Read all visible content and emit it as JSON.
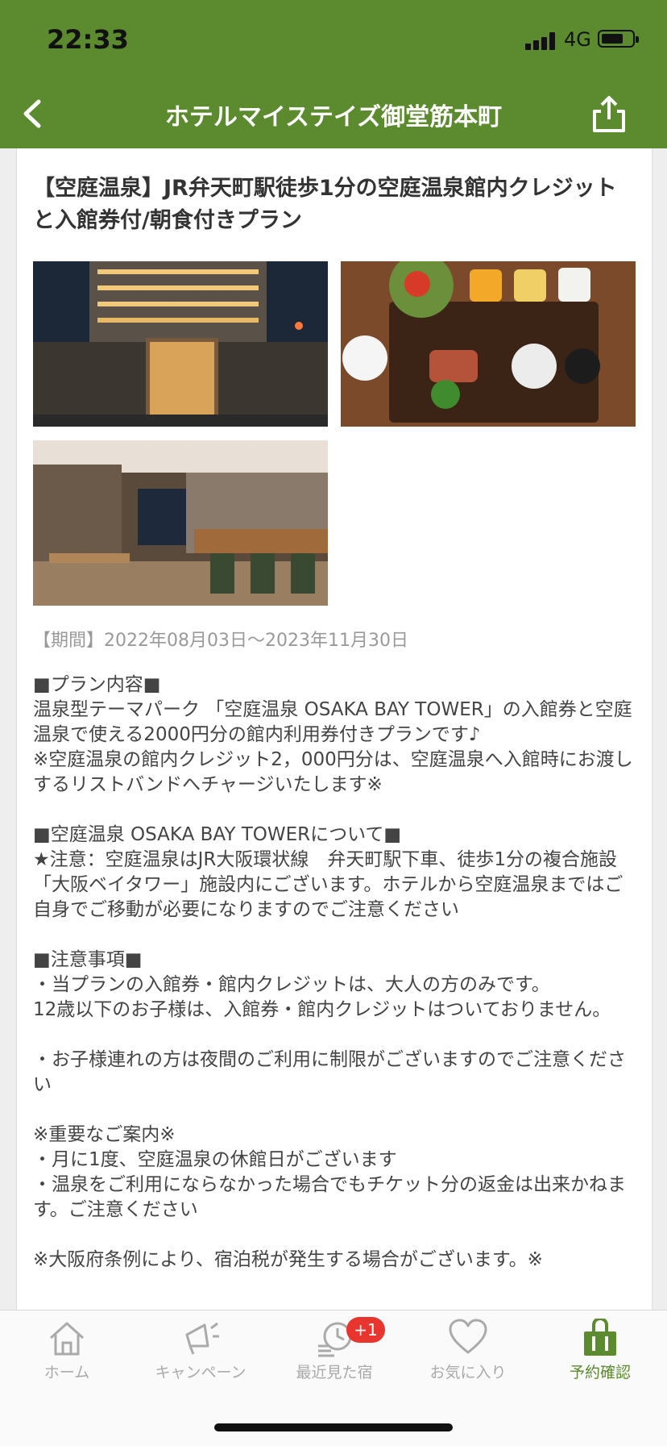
{
  "status": {
    "time": "22:33",
    "network": "4G"
  },
  "nav": {
    "title": "ホテルマイステイズ御堂筋本町",
    "back_icon": "chevron-left-icon",
    "share_icon": "share-icon"
  },
  "plan": {
    "title": "【空庭温泉】JR弁天町駅徒歩1分の空庭温泉館内クレジットと入館券付/朝食付きプラン",
    "period": "【期間】2022年08月03日～2023年11月30日",
    "photos": [
      "hotel-exterior",
      "breakfast",
      "restaurant-interior"
    ],
    "description": "■プラン内容■\n温泉型テーマパーク 「空庭温泉 OSAKA BAY TOWER」の入館券と空庭温泉で使える2000円分の館内利用券付きプランです♪\n※空庭温泉の館内クレジット2，000円分は、空庭温泉へ入館時にお渡しするリストバンドへチャージいたします※\n\n■空庭温泉 OSAKA BAY TOWERについて■\n★注意：空庭温泉はJR大阪環状線　弁天町駅下車、徒歩1分の複合施設「大阪ベイタワー」施設内にございます。ホテルから空庭温泉まではご自身でご移動が必要になりますのでご注意ください\n\n■注意事項■\n・当プランの入館券・館内クレジットは、大人の方のみです。\n12歳以下のお子様は、入館券・館内クレジットはついておりません。\n\n・お子様連れの方は夜間のご利用に制限がございますのでご注意ください\n\n※重要なご案内※\n・月に1度、空庭温泉の休館日がございます\n・温泉をご利用にならなかった場合でもチケット分の返金は出来かねます。ご注意ください\n\n※大阪府条例により、宿泊税が発生する場合がございます。※"
  },
  "tabbar": {
    "items": [
      {
        "label": "ホーム",
        "icon": "home-icon"
      },
      {
        "label": "キャンペーン",
        "icon": "megaphone-icon"
      },
      {
        "label": "最近見た宿",
        "icon": "history-icon",
        "badge": "+1"
      },
      {
        "label": "お気に入り",
        "icon": "heart-icon"
      },
      {
        "label": "予約確認",
        "icon": "bag-icon"
      }
    ],
    "active_index": 4
  },
  "colors": {
    "brand_green": "#5c8a2e",
    "badge_red": "#e8352e"
  }
}
